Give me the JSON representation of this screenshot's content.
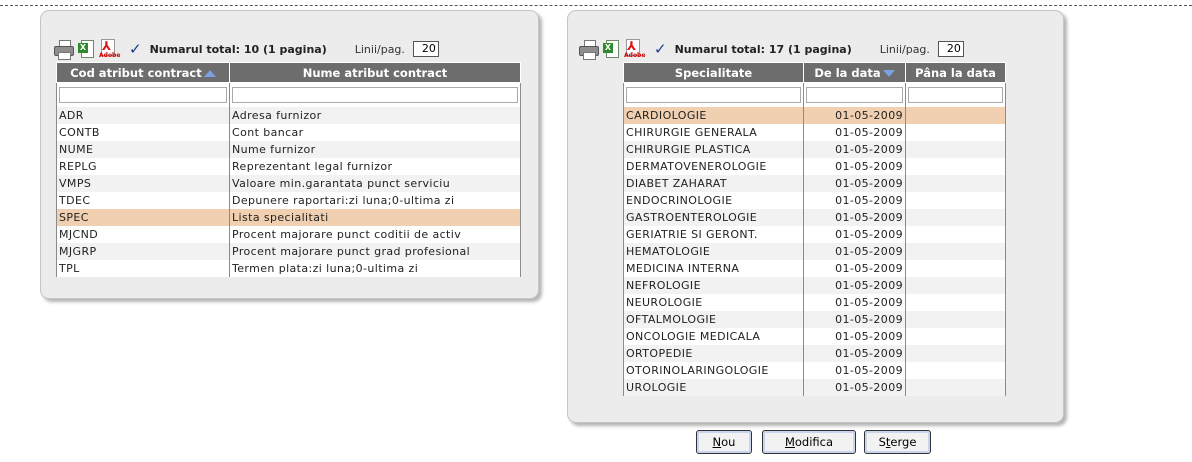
{
  "left_panel": {
    "total_text": "Numarul total: 10 (1 pagina)",
    "linii_label": "Linii/pag.",
    "linii_value": "20",
    "columns": [
      "Cod atribut contract",
      "Nume atribut contract"
    ],
    "rows": [
      {
        "code": "ADR",
        "name": "Adresa furnizor"
      },
      {
        "code": "CONTB",
        "name": "Cont bancar"
      },
      {
        "code": "NUME",
        "name": "Nume furnizor"
      },
      {
        "code": "REPLG",
        "name": "Reprezentant legal furnizor"
      },
      {
        "code": "VMPS",
        "name": "Valoare min.garantata punct serviciu"
      },
      {
        "code": "TDEC",
        "name": "Depunere raportari:zi luna;0-ultima zi"
      },
      {
        "code": "SPEC",
        "name": "Lista specialitati"
      },
      {
        "code": "MJCND",
        "name": "Procent majorare punct coditii de activ"
      },
      {
        "code": "MJGRP",
        "name": "Procent majorare punct grad profesional"
      },
      {
        "code": "TPL",
        "name": "Termen plata:zi luna;0-ultima zi"
      }
    ],
    "selected_index": 6
  },
  "right_panel": {
    "total_text": "Numarul total: 17 (1 pagina)",
    "linii_label": "Linii/pag.",
    "linii_value": "20",
    "columns": [
      "Specialitate",
      "De la data",
      "Pâna la data"
    ],
    "rows": [
      {
        "spec": "CARDIOLOGIE",
        "from": "01-05-2009",
        "to": ""
      },
      {
        "spec": "CHIRURGIE GENERALA",
        "from": "01-05-2009",
        "to": ""
      },
      {
        "spec": "CHIRURGIE PLASTICA",
        "from": "01-05-2009",
        "to": ""
      },
      {
        "spec": "DERMATOVENEROLOGIE",
        "from": "01-05-2009",
        "to": ""
      },
      {
        "spec": "DIABET ZAHARAT",
        "from": "01-05-2009",
        "to": ""
      },
      {
        "spec": "ENDOCRINOLOGIE",
        "from": "01-05-2009",
        "to": ""
      },
      {
        "spec": "GASTROENTEROLOGIE",
        "from": "01-05-2009",
        "to": ""
      },
      {
        "spec": "GERIATRIE SI GERONT.",
        "from": "01-05-2009",
        "to": ""
      },
      {
        "spec": "HEMATOLOGIE",
        "from": "01-05-2009",
        "to": ""
      },
      {
        "spec": "MEDICINA INTERNA",
        "from": "01-05-2009",
        "to": ""
      },
      {
        "spec": "NEFROLOGIE",
        "from": "01-05-2009",
        "to": ""
      },
      {
        "spec": "NEUROLOGIE",
        "from": "01-05-2009",
        "to": ""
      },
      {
        "spec": "OFTALMOLOGIE",
        "from": "01-05-2009",
        "to": ""
      },
      {
        "spec": "ONCOLOGIE MEDICALA",
        "from": "01-05-2009",
        "to": ""
      },
      {
        "spec": "ORTOPEDIE",
        "from": "01-05-2009",
        "to": ""
      },
      {
        "spec": "OTORINOLARINGOLOGIE",
        "from": "01-05-2009",
        "to": ""
      },
      {
        "spec": "UROLOGIE",
        "from": "01-05-2009",
        "to": ""
      }
    ],
    "selected_index": 0
  },
  "buttons": {
    "new": {
      "accel": "N",
      "rest": "ou"
    },
    "modify": {
      "accel": "M",
      "rest": "odifica"
    },
    "delete": {
      "prefix": "S",
      "accel": "t",
      "rest": "erge"
    }
  },
  "colors": {
    "header_bg": "#6d6d6d",
    "selected_row": "#f0d0b0",
    "panel_bg": "#ececec"
  }
}
